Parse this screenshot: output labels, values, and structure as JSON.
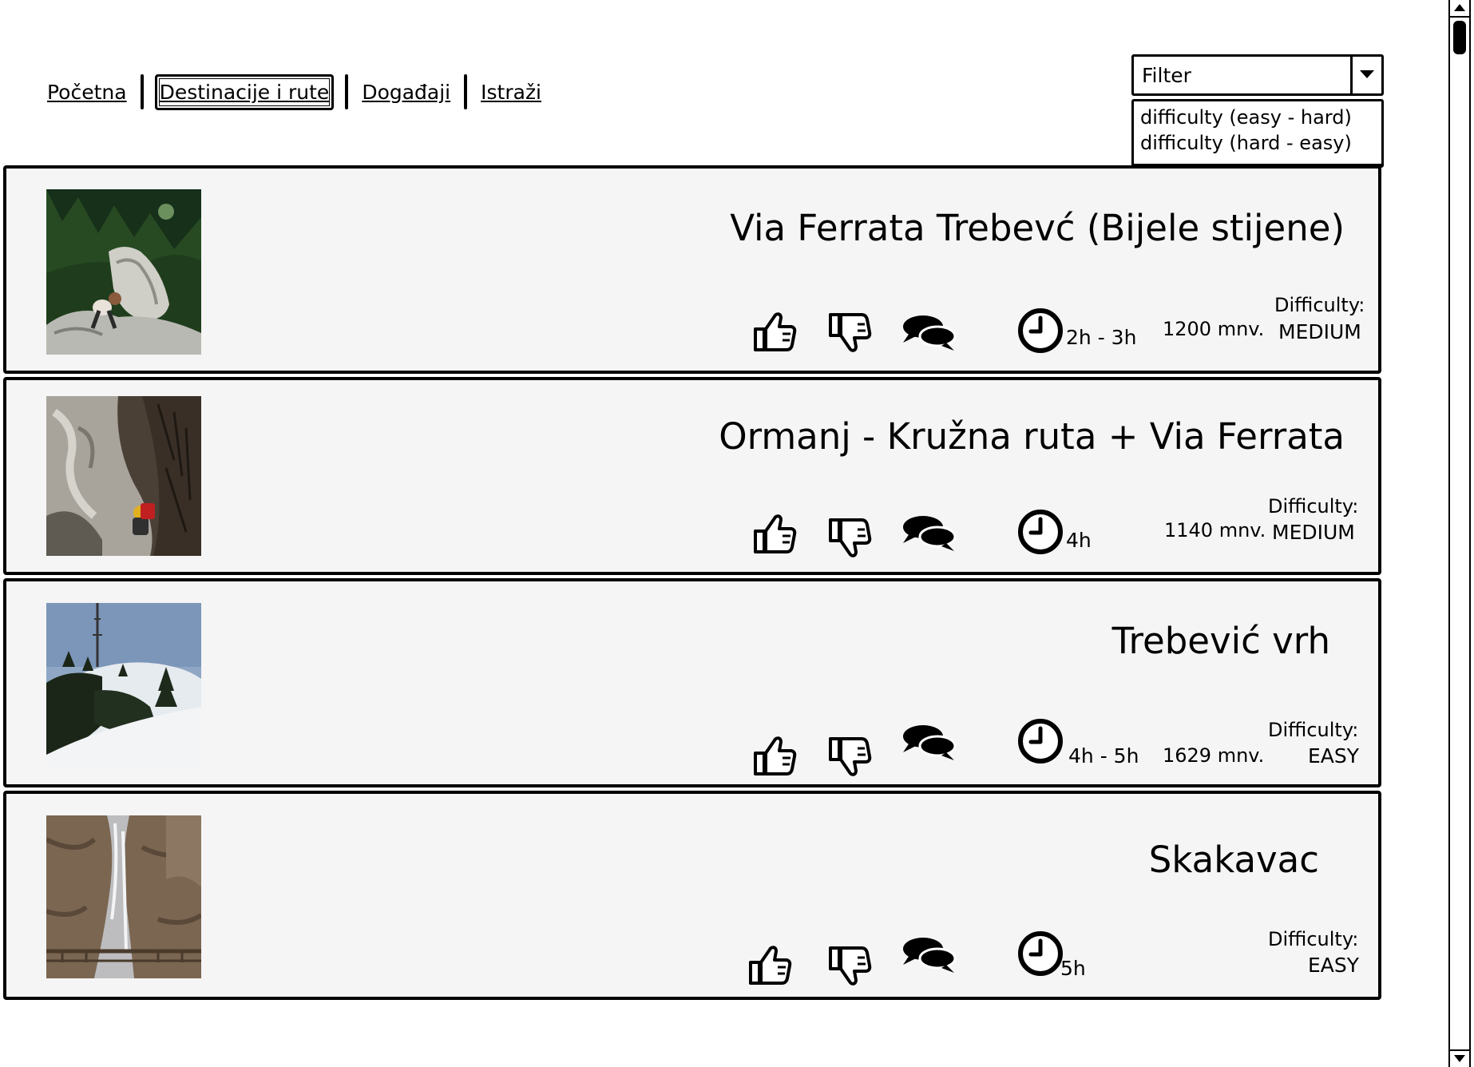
{
  "nav": {
    "items": [
      {
        "label": "Početna"
      },
      {
        "label": "Destinacije i rute"
      },
      {
        "label": "Događaji"
      },
      {
        "label": "Istraži"
      }
    ]
  },
  "filter": {
    "label": "Filter",
    "options": [
      "difficulty (easy - hard)",
      "difficulty (hard - easy)"
    ]
  },
  "routes": [
    {
      "title": "Via Ferrata Trebevć (Bijele stijene)",
      "duration": "2h - 3h",
      "elevation": "1200 mnv.",
      "difficulty_label": "Difficulty:",
      "difficulty": "MEDIUM",
      "photo": "rock-climbing-forest-photo"
    },
    {
      "title": "Ormanj - Kružna ruta + Via Ferrata",
      "duration": "4h",
      "elevation": "1140 mnv.",
      "difficulty_label": "Difficulty:",
      "difficulty": "MEDIUM",
      "photo": "climber-on-cliff-photo"
    },
    {
      "title": "Trebević vrh",
      "duration": "4h - 5h",
      "elevation": "1629 mnv.",
      "difficulty_label": "Difficulty:",
      "difficulty": "EASY",
      "photo": "snowy-peak-antenna-photo"
    },
    {
      "title": "Skakavac",
      "duration": "5h",
      "elevation": "",
      "difficulty_label": "Difficulty:",
      "difficulty": "EASY",
      "photo": "waterfall-photo"
    }
  ],
  "icons": {
    "like": "thumbs-up-icon",
    "dislike": "thumbs-down-icon",
    "comments": "speech-bubbles-icon",
    "duration": "clock-icon"
  },
  "colors": {
    "card_bg": "#f5f5f5",
    "border": "#000000"
  }
}
